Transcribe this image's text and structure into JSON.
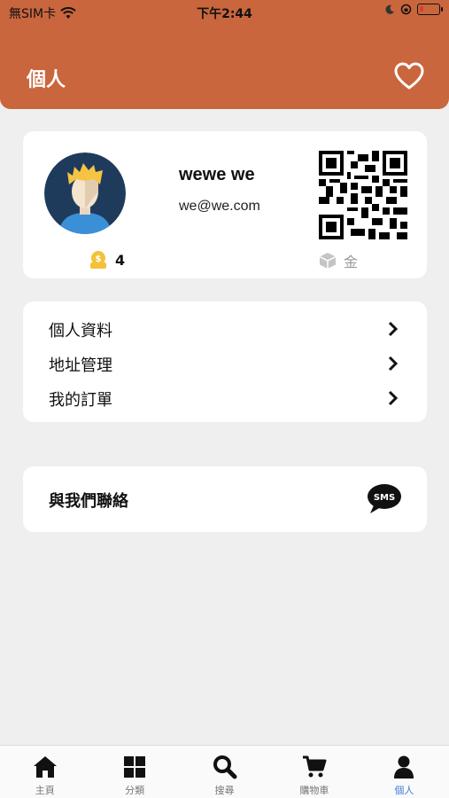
{
  "status_bar": {
    "carrier": "無SIM卡",
    "time": "下午2:44",
    "battery_level": 0.2
  },
  "header": {
    "title": "個人",
    "favorite_icon": "heart-outline-icon",
    "color": "#c9663d"
  },
  "profile": {
    "name": "wewe we",
    "email": "we@we.com",
    "coins": "4",
    "gold_label": "金"
  },
  "menu": {
    "items": [
      {
        "label": "個人資料"
      },
      {
        "label": "地址管理"
      },
      {
        "label": "我的訂單"
      }
    ]
  },
  "contact": {
    "label": "與我們聯絡",
    "icon_text": "SMS"
  },
  "tabbar": {
    "items": [
      {
        "label": "主頁",
        "icon": "home-icon"
      },
      {
        "label": "分類",
        "icon": "grid-icon"
      },
      {
        "label": "搜尋",
        "icon": "search-icon"
      },
      {
        "label": "購物車",
        "icon": "cart-icon"
      },
      {
        "label": "個人",
        "icon": "user-icon"
      }
    ],
    "active_color": "#3d7fd9"
  }
}
